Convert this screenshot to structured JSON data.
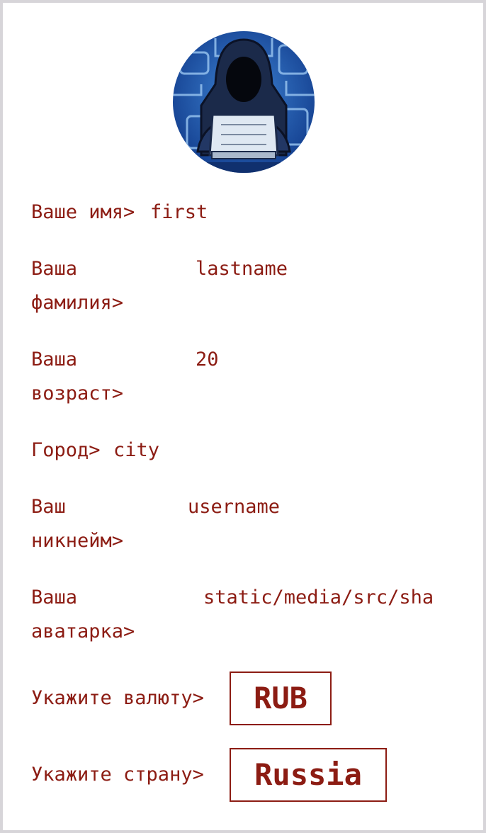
{
  "profile": {
    "avatar_icon": "hacker-avatar-icon",
    "fields": [
      {
        "label": "Ваше имя>",
        "value": "first"
      },
      {
        "label_line1": "Ваша",
        "label_line2": "фамилия>",
        "value": "lastname"
      },
      {
        "label_line1": "Ваша",
        "label_line2": "возраст>",
        "value": "20"
      },
      {
        "label": "Город>",
        "value": "city"
      },
      {
        "label_line1": "Ваш",
        "label_line2": "никнейм>",
        "value": "username"
      },
      {
        "label_line1": "Ваша",
        "label_line2": "аватарка>",
        "value": "static/media/src/sha"
      }
    ],
    "currency": {
      "label": "Укажите валюту>",
      "value": "RUB"
    },
    "country": {
      "label": "Укажите страну>",
      "value": "Russia"
    }
  },
  "colors": {
    "text": "#8c1c13",
    "frame": "#d7d5d9"
  }
}
